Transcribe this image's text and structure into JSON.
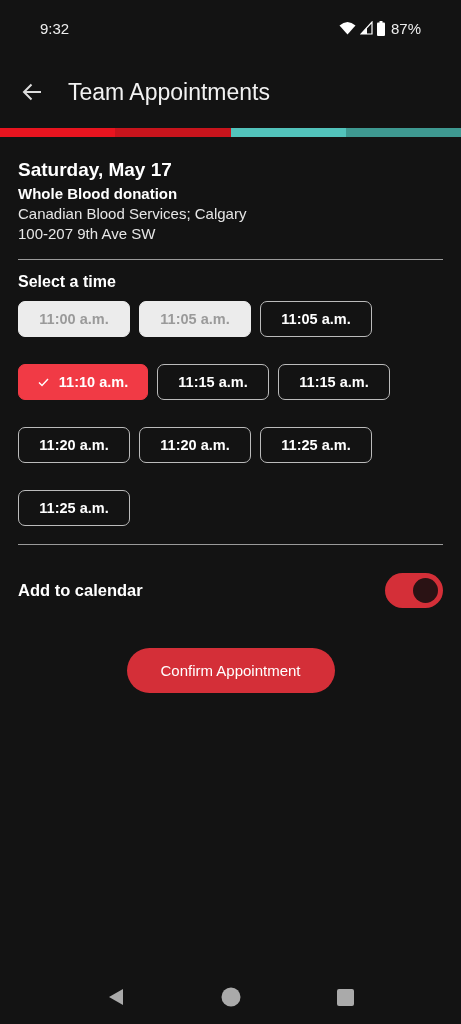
{
  "status_bar": {
    "time": "9:32",
    "battery": "87%"
  },
  "header": {
    "title": "Team Appointments"
  },
  "progress_steps": [
    {
      "color": "#e8141f"
    },
    {
      "color": "#c8141c"
    },
    {
      "color": "#52c3bb"
    },
    {
      "color": "#3e9991"
    }
  ],
  "appointment": {
    "date": "Saturday, May 17",
    "type": "Whole Blood donation",
    "location": "Canadian Blood Services; Calgary",
    "address": "100-207 9th Ave SW"
  },
  "time_section": {
    "heading": "Select a time",
    "slots": [
      {
        "label": "11:00 a.m.",
        "disabled": true,
        "selected": false
      },
      {
        "label": "11:05 a.m.",
        "disabled": true,
        "selected": false
      },
      {
        "label": "11:05 a.m.",
        "disabled": false,
        "selected": false
      },
      {
        "label": "11:10 a.m.",
        "disabled": false,
        "selected": true
      },
      {
        "label": "11:15 a.m.",
        "disabled": false,
        "selected": false
      },
      {
        "label": "11:15 a.m.",
        "disabled": false,
        "selected": false
      },
      {
        "label": "11:20 a.m.",
        "disabled": false,
        "selected": false
      },
      {
        "label": "11:20 a.m.",
        "disabled": false,
        "selected": false
      },
      {
        "label": "11:25 a.m.",
        "disabled": false,
        "selected": false
      },
      {
        "label": "11:25 a.m.",
        "disabled": false,
        "selected": false
      }
    ]
  },
  "calendar_toggle": {
    "label": "Add to calendar",
    "on": true
  },
  "confirm_button": {
    "label": "Confirm Appointment"
  }
}
